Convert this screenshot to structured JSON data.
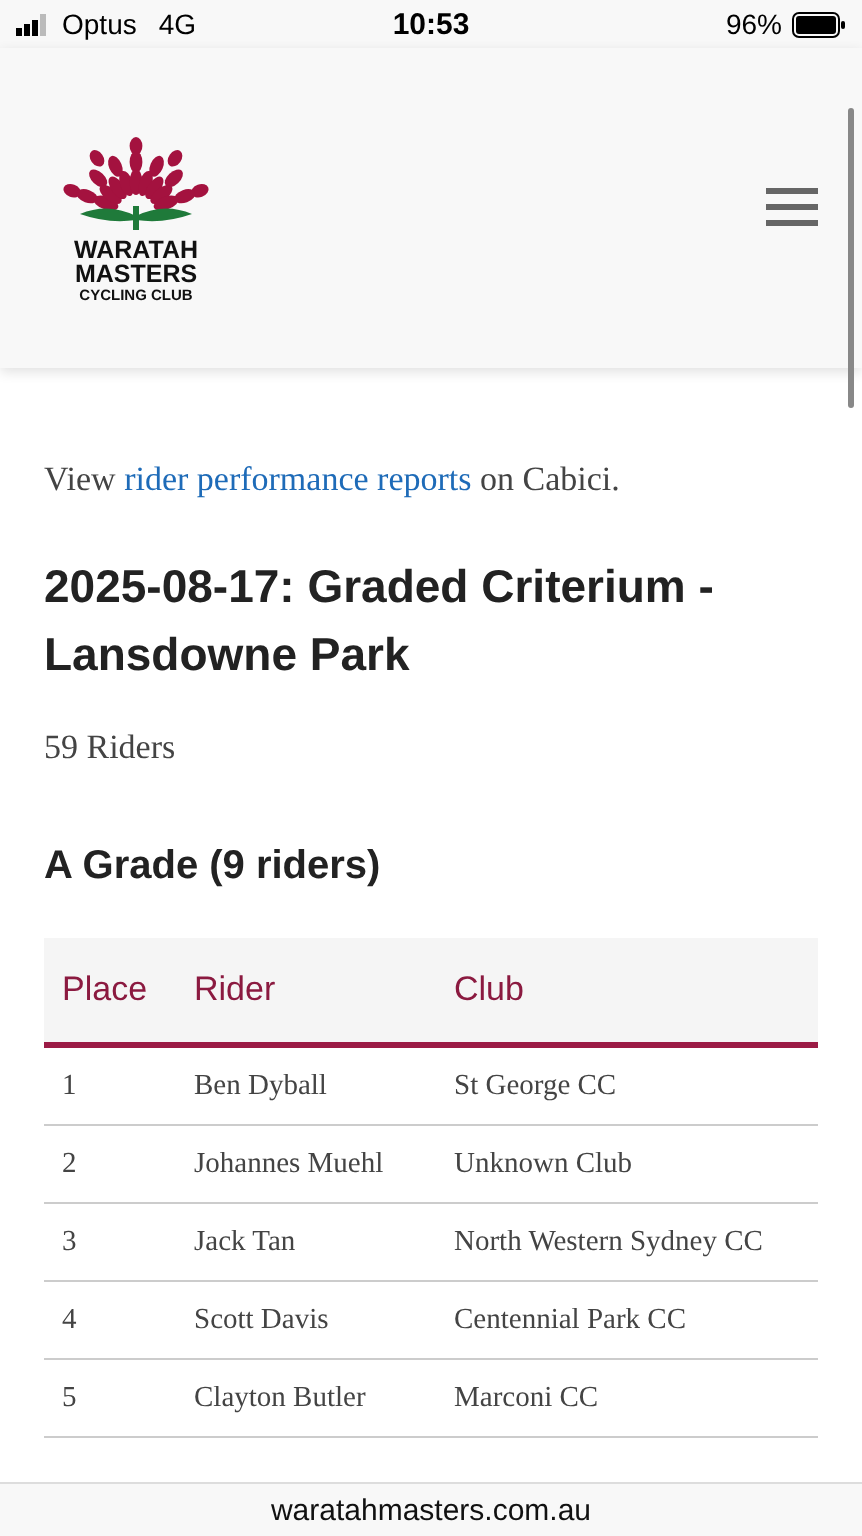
{
  "status_bar": {
    "carrier": "Optus",
    "network": "4G",
    "time": "10:53",
    "battery": "96%"
  },
  "header": {
    "logo_lines": [
      "WARATAH",
      "MASTERS",
      "CYCLING CLUB"
    ]
  },
  "intro": {
    "prefix": "View ",
    "link": "rider performance reports",
    "suffix": " on Cabici."
  },
  "event_title": "2025-08-17: Graded Criterium - Lansdowne Park",
  "rider_count": "59 Riders",
  "grade_title": "A Grade (9 riders)",
  "table": {
    "columns": [
      "Place",
      "Rider",
      "Club"
    ],
    "rows": [
      {
        "place": "1",
        "rider": "Ben Dyball",
        "club": "St George CC"
      },
      {
        "place": "2",
        "rider": "Johannes Muehl",
        "club": "Unknown Club"
      },
      {
        "place": "3",
        "rider": "Jack Tan",
        "club": "North Western Sydney CC"
      },
      {
        "place": "4",
        "rider": "Scott Davis",
        "club": "Centennial Park CC"
      },
      {
        "place": "5",
        "rider": "Clayton Butler",
        "club": "Marconi CC"
      }
    ]
  },
  "address_bar": {
    "url": "waratahmasters.com.au"
  }
}
